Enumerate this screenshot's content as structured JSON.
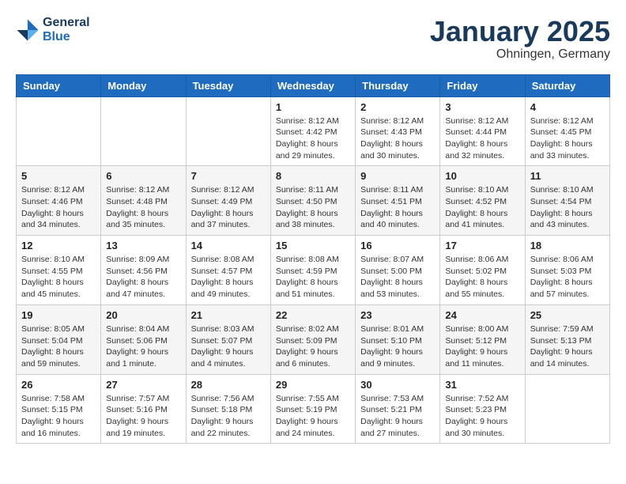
{
  "header": {
    "logo_line1": "General",
    "logo_line2": "Blue",
    "month": "January 2025",
    "location": "Ohningen, Germany"
  },
  "weekdays": [
    "Sunday",
    "Monday",
    "Tuesday",
    "Wednesday",
    "Thursday",
    "Friday",
    "Saturday"
  ],
  "weeks": [
    [
      {
        "day": "",
        "info": ""
      },
      {
        "day": "",
        "info": ""
      },
      {
        "day": "",
        "info": ""
      },
      {
        "day": "1",
        "info": "Sunrise: 8:12 AM\nSunset: 4:42 PM\nDaylight: 8 hours\nand 29 minutes."
      },
      {
        "day": "2",
        "info": "Sunrise: 8:12 AM\nSunset: 4:43 PM\nDaylight: 8 hours\nand 30 minutes."
      },
      {
        "day": "3",
        "info": "Sunrise: 8:12 AM\nSunset: 4:44 PM\nDaylight: 8 hours\nand 32 minutes."
      },
      {
        "day": "4",
        "info": "Sunrise: 8:12 AM\nSunset: 4:45 PM\nDaylight: 8 hours\nand 33 minutes."
      }
    ],
    [
      {
        "day": "5",
        "info": "Sunrise: 8:12 AM\nSunset: 4:46 PM\nDaylight: 8 hours\nand 34 minutes."
      },
      {
        "day": "6",
        "info": "Sunrise: 8:12 AM\nSunset: 4:48 PM\nDaylight: 8 hours\nand 35 minutes."
      },
      {
        "day": "7",
        "info": "Sunrise: 8:12 AM\nSunset: 4:49 PM\nDaylight: 8 hours\nand 37 minutes."
      },
      {
        "day": "8",
        "info": "Sunrise: 8:11 AM\nSunset: 4:50 PM\nDaylight: 8 hours\nand 38 minutes."
      },
      {
        "day": "9",
        "info": "Sunrise: 8:11 AM\nSunset: 4:51 PM\nDaylight: 8 hours\nand 40 minutes."
      },
      {
        "day": "10",
        "info": "Sunrise: 8:10 AM\nSunset: 4:52 PM\nDaylight: 8 hours\nand 41 minutes."
      },
      {
        "day": "11",
        "info": "Sunrise: 8:10 AM\nSunset: 4:54 PM\nDaylight: 8 hours\nand 43 minutes."
      }
    ],
    [
      {
        "day": "12",
        "info": "Sunrise: 8:10 AM\nSunset: 4:55 PM\nDaylight: 8 hours\nand 45 minutes."
      },
      {
        "day": "13",
        "info": "Sunrise: 8:09 AM\nSunset: 4:56 PM\nDaylight: 8 hours\nand 47 minutes."
      },
      {
        "day": "14",
        "info": "Sunrise: 8:08 AM\nSunset: 4:57 PM\nDaylight: 8 hours\nand 49 minutes."
      },
      {
        "day": "15",
        "info": "Sunrise: 8:08 AM\nSunset: 4:59 PM\nDaylight: 8 hours\nand 51 minutes."
      },
      {
        "day": "16",
        "info": "Sunrise: 8:07 AM\nSunset: 5:00 PM\nDaylight: 8 hours\nand 53 minutes."
      },
      {
        "day": "17",
        "info": "Sunrise: 8:06 AM\nSunset: 5:02 PM\nDaylight: 8 hours\nand 55 minutes."
      },
      {
        "day": "18",
        "info": "Sunrise: 8:06 AM\nSunset: 5:03 PM\nDaylight: 8 hours\nand 57 minutes."
      }
    ],
    [
      {
        "day": "19",
        "info": "Sunrise: 8:05 AM\nSunset: 5:04 PM\nDaylight: 8 hours\nand 59 minutes."
      },
      {
        "day": "20",
        "info": "Sunrise: 8:04 AM\nSunset: 5:06 PM\nDaylight: 9 hours\nand 1 minute."
      },
      {
        "day": "21",
        "info": "Sunrise: 8:03 AM\nSunset: 5:07 PM\nDaylight: 9 hours\nand 4 minutes."
      },
      {
        "day": "22",
        "info": "Sunrise: 8:02 AM\nSunset: 5:09 PM\nDaylight: 9 hours\nand 6 minutes."
      },
      {
        "day": "23",
        "info": "Sunrise: 8:01 AM\nSunset: 5:10 PM\nDaylight: 9 hours\nand 9 minutes."
      },
      {
        "day": "24",
        "info": "Sunrise: 8:00 AM\nSunset: 5:12 PM\nDaylight: 9 hours\nand 11 minutes."
      },
      {
        "day": "25",
        "info": "Sunrise: 7:59 AM\nSunset: 5:13 PM\nDaylight: 9 hours\nand 14 minutes."
      }
    ],
    [
      {
        "day": "26",
        "info": "Sunrise: 7:58 AM\nSunset: 5:15 PM\nDaylight: 9 hours\nand 16 minutes."
      },
      {
        "day": "27",
        "info": "Sunrise: 7:57 AM\nSunset: 5:16 PM\nDaylight: 9 hours\nand 19 minutes."
      },
      {
        "day": "28",
        "info": "Sunrise: 7:56 AM\nSunset: 5:18 PM\nDaylight: 9 hours\nand 22 minutes."
      },
      {
        "day": "29",
        "info": "Sunrise: 7:55 AM\nSunset: 5:19 PM\nDaylight: 9 hours\nand 24 minutes."
      },
      {
        "day": "30",
        "info": "Sunrise: 7:53 AM\nSunset: 5:21 PM\nDaylight: 9 hours\nand 27 minutes."
      },
      {
        "day": "31",
        "info": "Sunrise: 7:52 AM\nSunset: 5:23 PM\nDaylight: 9 hours\nand 30 minutes."
      },
      {
        "day": "",
        "info": ""
      }
    ]
  ]
}
